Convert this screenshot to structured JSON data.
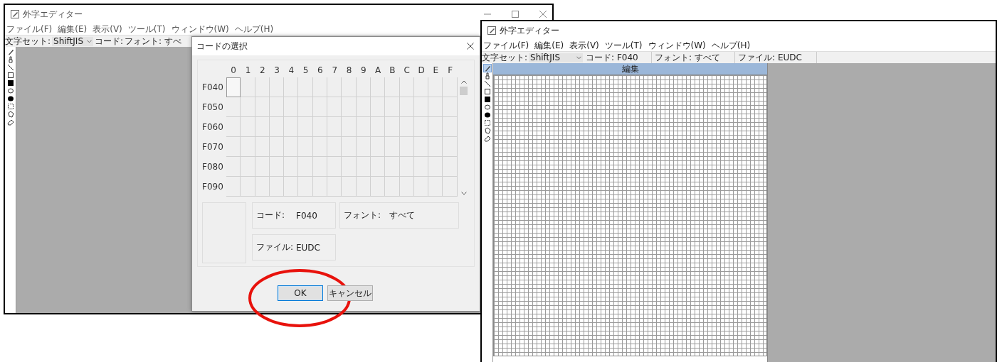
{
  "left_window": {
    "title": "外字エディター",
    "menu": [
      "ファイル(F)",
      "編集(E)",
      "表示(V)",
      "ツール(T)",
      "ウィンドウ(W)",
      "ヘルプ(H)"
    ],
    "toolbar": {
      "charset_label": "文字セット:",
      "charset_value": "ShiftJIS",
      "code_label": "コード:",
      "font_label": "フォント: すべ"
    },
    "tools": [
      {
        "kind": "pencil",
        "selected": false
      },
      {
        "kind": "brush",
        "selected": false
      },
      {
        "kind": "line",
        "selected": false
      },
      {
        "kind": "rect",
        "selected": false
      },
      {
        "kind": "filled-rect",
        "selected": false
      },
      {
        "kind": "ellipse",
        "selected": false
      },
      {
        "kind": "filled-ellipse",
        "selected": false
      },
      {
        "kind": "rect-select",
        "selected": false
      },
      {
        "kind": "lasso",
        "selected": false
      },
      {
        "kind": "eraser",
        "selected": false
      }
    ]
  },
  "dialog": {
    "title": "コードの選択",
    "columns": [
      "0",
      "1",
      "2",
      "3",
      "4",
      "5",
      "6",
      "7",
      "8",
      "9",
      "A",
      "B",
      "C",
      "D",
      "E",
      "F"
    ],
    "rows": [
      {
        "label": "F040",
        "cells": [
          {
            "selected": true
          },
          {
            "selected": false
          },
          {
            "selected": false
          },
          {
            "selected": false
          },
          {
            "selected": false
          },
          {
            "selected": false
          },
          {
            "selected": false
          },
          {
            "selected": false
          },
          {
            "selected": false
          },
          {
            "selected": false
          },
          {
            "selected": false
          },
          {
            "selected": false
          },
          {
            "selected": false
          },
          {
            "selected": false
          },
          {
            "selected": false
          },
          {
            "selected": false
          }
        ]
      },
      {
        "label": "F050",
        "cells": [
          {
            "selected": false
          },
          {
            "selected": false
          },
          {
            "selected": false
          },
          {
            "selected": false
          },
          {
            "selected": false
          },
          {
            "selected": false
          },
          {
            "selected": false
          },
          {
            "selected": false
          },
          {
            "selected": false
          },
          {
            "selected": false
          },
          {
            "selected": false
          },
          {
            "selected": false
          },
          {
            "selected": false
          },
          {
            "selected": false
          },
          {
            "selected": false
          },
          {
            "selected": false
          }
        ]
      },
      {
        "label": "F060",
        "cells": [
          {
            "selected": false
          },
          {
            "selected": false
          },
          {
            "selected": false
          },
          {
            "selected": false
          },
          {
            "selected": false
          },
          {
            "selected": false
          },
          {
            "selected": false
          },
          {
            "selected": false
          },
          {
            "selected": false
          },
          {
            "selected": false
          },
          {
            "selected": false
          },
          {
            "selected": false
          },
          {
            "selected": false
          },
          {
            "selected": false
          },
          {
            "selected": false
          },
          {
            "selected": false
          }
        ]
      },
      {
        "label": "F070",
        "cells": [
          {
            "selected": false
          },
          {
            "selected": false
          },
          {
            "selected": false
          },
          {
            "selected": false
          },
          {
            "selected": false
          },
          {
            "selected": false
          },
          {
            "selected": false
          },
          {
            "selected": false
          },
          {
            "selected": false
          },
          {
            "selected": false
          },
          {
            "selected": false
          },
          {
            "selected": false
          },
          {
            "selected": false
          },
          {
            "selected": false
          },
          {
            "selected": false
          },
          {
            "selected": false
          }
        ]
      },
      {
        "label": "F080",
        "cells": [
          {
            "selected": false
          },
          {
            "selected": false
          },
          {
            "selected": false
          },
          {
            "selected": false
          },
          {
            "selected": false
          },
          {
            "selected": false
          },
          {
            "selected": false
          },
          {
            "selected": false
          },
          {
            "selected": false
          },
          {
            "selected": false
          },
          {
            "selected": false
          },
          {
            "selected": false
          },
          {
            "selected": false
          },
          {
            "selected": false
          },
          {
            "selected": false
          },
          {
            "selected": false
          }
        ]
      },
      {
        "label": "F090",
        "cells": [
          {
            "selected": false
          },
          {
            "selected": false
          },
          {
            "selected": false
          },
          {
            "selected": false
          },
          {
            "selected": false
          },
          {
            "selected": false
          },
          {
            "selected": false
          },
          {
            "selected": false
          },
          {
            "selected": false
          },
          {
            "selected": false
          },
          {
            "selected": false
          },
          {
            "selected": false
          },
          {
            "selected": false
          },
          {
            "selected": false
          },
          {
            "selected": false
          },
          {
            "selected": false
          }
        ]
      }
    ],
    "code_label": "コード:",
    "code_value": "F040",
    "font_label": "フォント:",
    "font_value": "すべて",
    "file_label": "ファイル:",
    "file_value": "EUDC",
    "buttons": [
      {
        "label": "OK",
        "default": true
      },
      {
        "label": "キャンセル",
        "default": false
      }
    ]
  },
  "annotation": {
    "kind": "ellipse"
  },
  "right_window": {
    "title": "外字エディター",
    "menu": [
      "ファイル(F)",
      "編集(E)",
      "表示(V)",
      "ツール(T)",
      "ウィンドウ(W)",
      "ヘルプ(H)"
    ],
    "toolbar": {
      "charset_label": "文字セット:",
      "charset_value": "ShiftJIS",
      "code": "コード: F040",
      "font": "フォント: すべて",
      "file": "ファイル: EUDC"
    },
    "tools": [
      {
        "kind": "pencil",
        "selected": true
      },
      {
        "kind": "brush",
        "selected": false
      },
      {
        "kind": "line",
        "selected": false
      },
      {
        "kind": "rect",
        "selected": false
      },
      {
        "kind": "filled-rect",
        "selected": false
      },
      {
        "kind": "ellipse",
        "selected": false
      },
      {
        "kind": "filled-ellipse",
        "selected": false
      },
      {
        "kind": "rect-select",
        "selected": false
      },
      {
        "kind": "lasso",
        "selected": false
      },
      {
        "kind": "eraser",
        "selected": false
      }
    ],
    "edit_panel": {
      "title": "編集"
    }
  }
}
